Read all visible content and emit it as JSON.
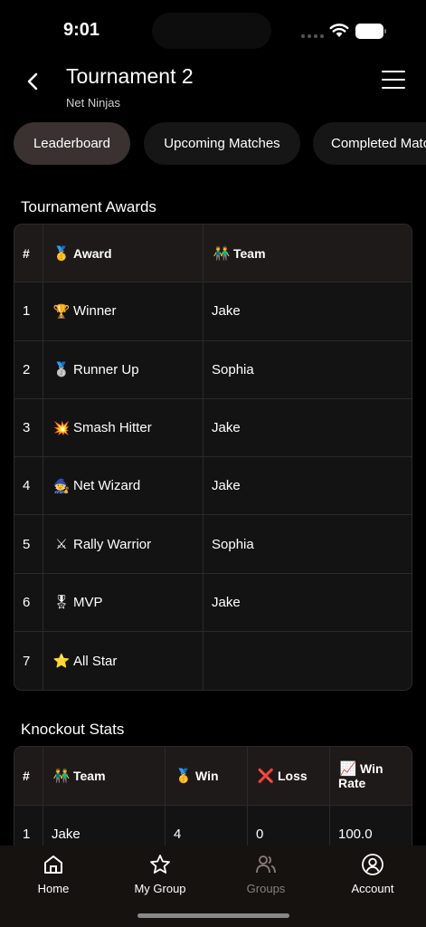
{
  "status": {
    "time": "9:01"
  },
  "header": {
    "title": "Tournament 2",
    "subtitle": "Net Ninjas"
  },
  "tabs": [
    {
      "label": "Leaderboard",
      "active": true
    },
    {
      "label": "Upcoming Matches",
      "active": false
    },
    {
      "label": "Completed Matches",
      "active": false
    }
  ],
  "awards": {
    "title": "Tournament Awards",
    "headers": {
      "num": "#",
      "award_icon": "🥇",
      "award": "Award",
      "team_icon": "👬",
      "team": "Team"
    },
    "rows": [
      {
        "num": "1",
        "icon": "🏆",
        "award": "Winner",
        "team": "Jake"
      },
      {
        "num": "2",
        "icon": "🥈",
        "award": "Runner Up",
        "team": "Sophia"
      },
      {
        "num": "3",
        "icon": "💥",
        "award": "Smash Hitter",
        "team": "Jake"
      },
      {
        "num": "4",
        "icon": "🧙",
        "award": "Net Wizard",
        "team": "Jake"
      },
      {
        "num": "5",
        "icon": "⚔",
        "award": "Rally Warrior",
        "team": "Sophia"
      },
      {
        "num": "6",
        "icon": "🎖",
        "award": "MVP",
        "team": "Jake"
      },
      {
        "num": "7",
        "icon": "⭐",
        "award": "All Star",
        "team": ""
      }
    ]
  },
  "knockout": {
    "title": "Knockout Stats",
    "headers": {
      "num": "#",
      "team_icon": "👬",
      "team": "Team",
      "win_icon": "🥇",
      "win": "Win",
      "loss_icon": "❌",
      "loss": "Loss",
      "rate_icon": "📈",
      "rate_line1": "Win",
      "rate_line2": "Rate"
    },
    "rows": [
      {
        "num": "1",
        "team": "Jake",
        "win": "4",
        "loss": "0",
        "rate": "100.0"
      }
    ]
  },
  "nav": {
    "items": [
      {
        "label": "Home",
        "icon": "home-icon"
      },
      {
        "label": "My Group",
        "icon": "star-icon"
      },
      {
        "label": "Groups",
        "icon": "groups-icon",
        "active": true
      },
      {
        "label": "Account",
        "icon": "account-icon"
      }
    ]
  },
  "colors": {
    "background": "#000000",
    "active_tab": "#3b3130",
    "nav_active": "#8a7f7c"
  }
}
